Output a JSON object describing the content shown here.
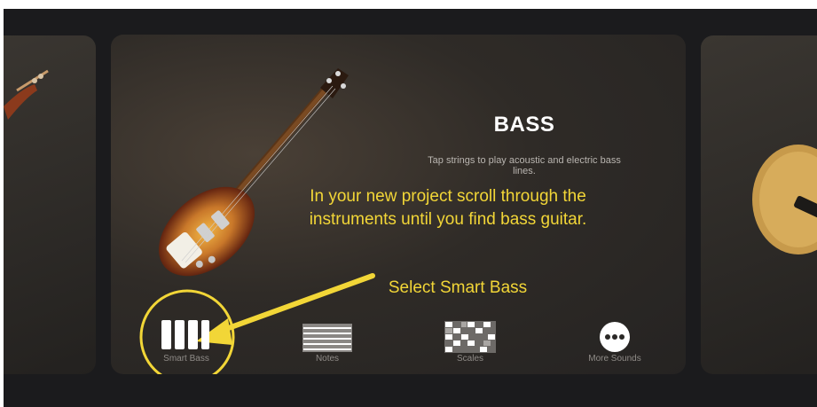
{
  "instrument": {
    "title": "BASS",
    "description": "Tap strings to play acoustic and electric bass lines."
  },
  "annotation": {
    "instructions": "In your new project scroll through the instruments until you find bass guitar.",
    "callout": "Select Smart Bass",
    "highlight_color": "#f2d637"
  },
  "options": [
    {
      "label": "Smart Bass",
      "icon": "smart-bass-icon"
    },
    {
      "label": "Notes",
      "icon": "notes-icon"
    },
    {
      "label": "Scales",
      "icon": "scales-icon"
    },
    {
      "label": "More Sounds",
      "icon": "more-icon"
    }
  ]
}
